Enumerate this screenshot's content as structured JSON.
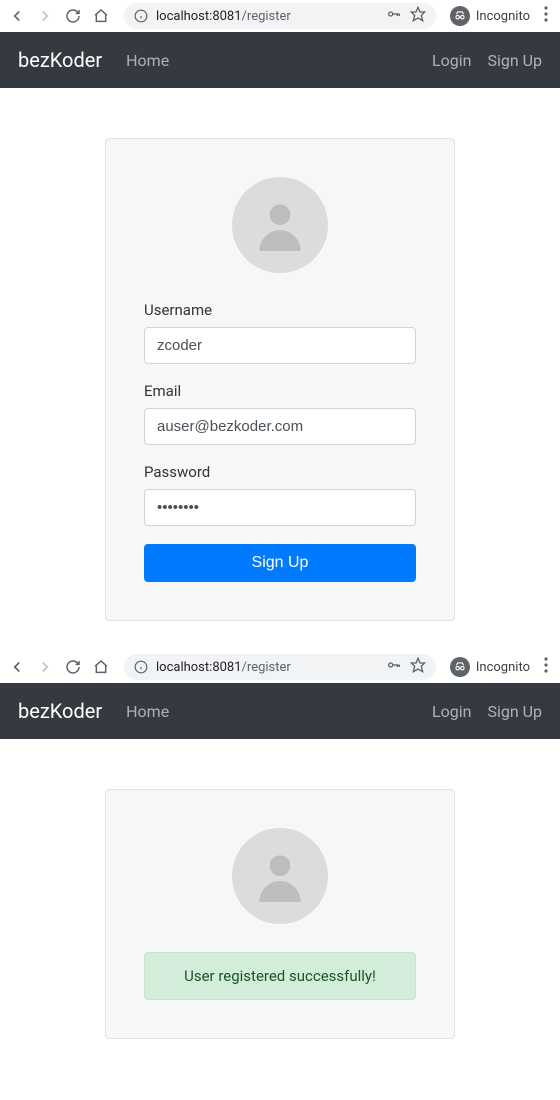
{
  "browser": {
    "url_host": "localhost:",
    "url_port": "8081",
    "url_path": "/register",
    "incognito_label": "Incognito"
  },
  "navbar": {
    "brand": "bezKoder",
    "home": "Home",
    "login": "Login",
    "signup": "Sign Up"
  },
  "form": {
    "username_label": "Username",
    "username_value": "zcoder",
    "email_label": "Email",
    "email_value": "auser@bezkoder.com",
    "password_label": "Password",
    "password_value": "••••••••",
    "submit_label": "Sign Up"
  },
  "success": {
    "message": "User registered successfully!"
  }
}
